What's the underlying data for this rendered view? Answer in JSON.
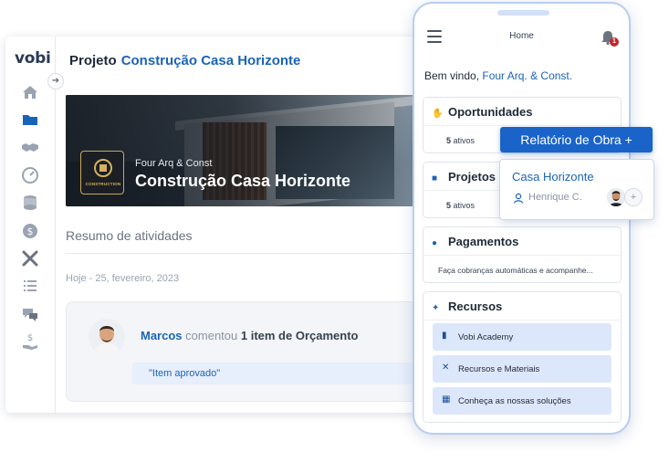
{
  "app": {
    "logo_text": "vobi"
  },
  "sidebar": {
    "collapse_icon": "arrow-right-icon",
    "items": [
      {
        "name": "home",
        "icon": "home-icon"
      },
      {
        "name": "projects",
        "icon": "folder-icon",
        "active": true
      },
      {
        "name": "opportunities",
        "icon": "handshake-icon"
      },
      {
        "name": "dashboard",
        "icon": "gauge-icon"
      },
      {
        "name": "finance",
        "icon": "coins-icon"
      },
      {
        "name": "payments",
        "icon": "dollar-icon"
      },
      {
        "name": "tools",
        "icon": "tools-icon"
      },
      {
        "name": "lists",
        "icon": "list-icon"
      },
      {
        "name": "messages",
        "icon": "chat-icon"
      },
      {
        "name": "receivables",
        "icon": "money-hand-icon"
      }
    ]
  },
  "project": {
    "title_lead": "Projeto",
    "title_name": "Construção Casa Horizonte",
    "banner_company": "Four Arq & Const",
    "banner_title": "Construção Casa Horizonte",
    "logo_caption": "CONSTRUCTION"
  },
  "activity": {
    "section_title": "Resumo de atividades",
    "date_label": "Hoje - 25, fevereiro, 2023",
    "entry": {
      "user": "Marcos",
      "verb": "comentou",
      "object": "1 item de Orçamento",
      "quote": "\"Item aprovado\""
    }
  },
  "mobile": {
    "header_title": "Home",
    "notification_count": "1",
    "welcome_lead": "Bem vindo,",
    "welcome_company": "Four Arq. & Const.",
    "cards": {
      "opportunities": {
        "title": "Oportunidades",
        "count": "5",
        "suffix": "ativos"
      },
      "projects": {
        "title": "Projetos e",
        "count": "5",
        "suffix": "ativos"
      },
      "payments": {
        "title": "Pagamentos",
        "text": "Faça cobranças automáticas e acompanhe..."
      },
      "resources": {
        "title": "Recursos",
        "items": [
          {
            "label": "Vobi Academy",
            "icon": "book-icon"
          },
          {
            "label": "Recursos e Materiais",
            "icon": "tools-icon"
          },
          {
            "label": "Conheça as nossas soluções",
            "icon": "grid-icon"
          }
        ]
      }
    }
  },
  "overlay": {
    "report_button": "Relatório de Obra +",
    "popup_title": "Casa Horizonte",
    "popup_user": "Henrique C.",
    "add_label": "+"
  },
  "colors": {
    "accent": "#1a64b8",
    "button": "#1a64c9",
    "badge": "#c0282d"
  }
}
